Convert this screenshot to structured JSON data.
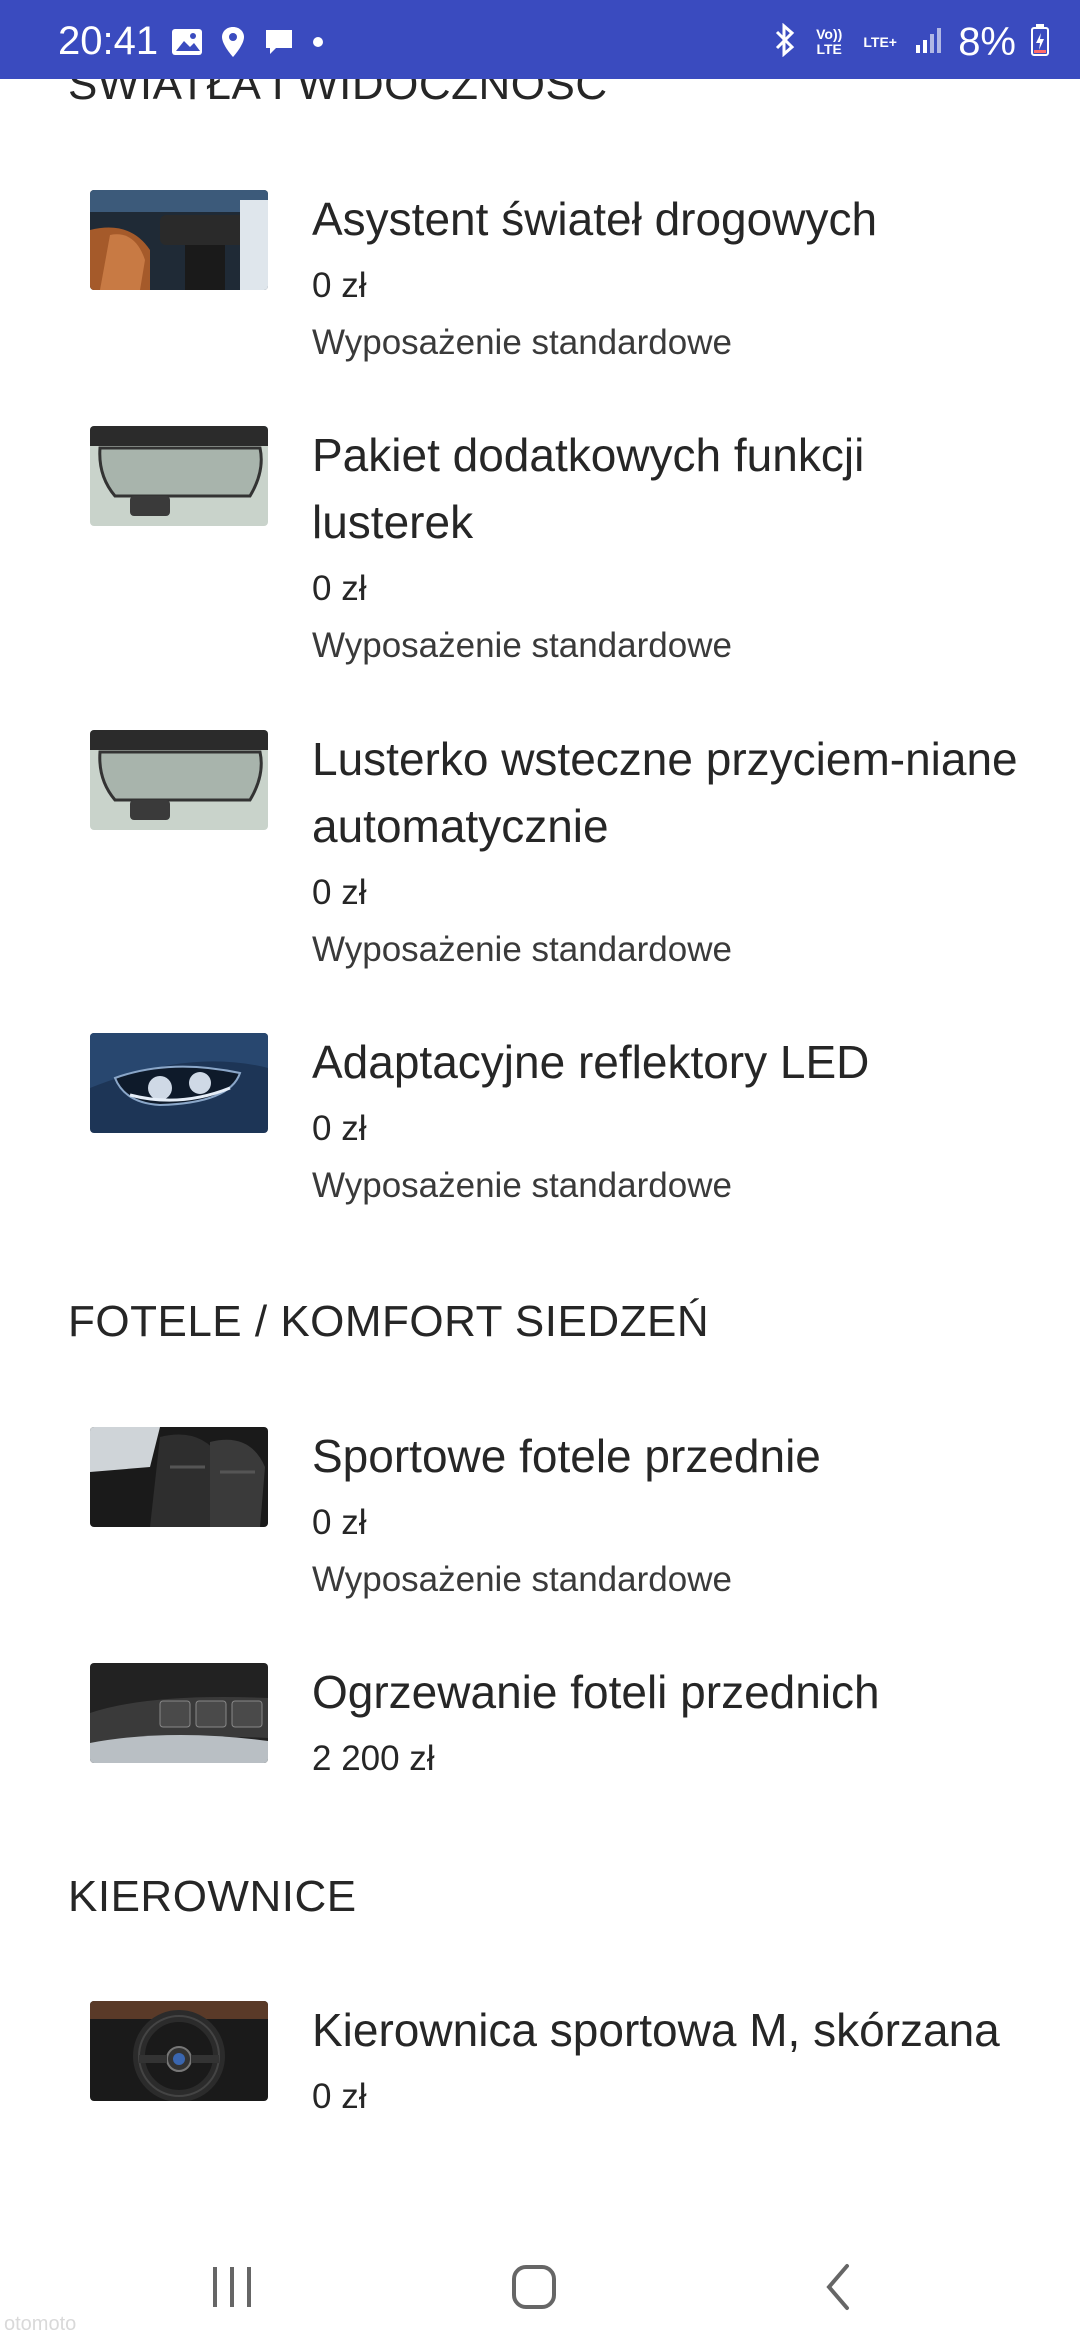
{
  "status_bar": {
    "time": "20:41",
    "left_icons": [
      "gallery-icon",
      "location-icon",
      "chat-icon",
      "dot-icon"
    ],
    "volte_label": "Vo)) LTE",
    "lte_label": "LTE+",
    "battery_percent": "8%",
    "right_icons": [
      "bluetooth-icon",
      "signal-icon",
      "battery-icon"
    ]
  },
  "sections": [
    {
      "title": "ŚWIATŁA I WIDOCZNOŚĆ",
      "items": [
        {
          "title": "Asystent świateł drogowych",
          "price": "0 zł",
          "note": "Wyposażenie standardowe"
        },
        {
          "title": "Pakiet dodatkowych funkcji lusterek",
          "price": "0 zł",
          "note": "Wyposażenie standardowe"
        },
        {
          "title": "Lusterko wsteczne przyciem-niane automatycznie",
          "price": "0 zł",
          "note": "Wyposażenie standardowe"
        },
        {
          "title": "Adaptacyjne reflektory LED",
          "price": "0 zł",
          "note": "Wyposażenie standardowe"
        }
      ]
    },
    {
      "title": "FOTELE / KOMFORT SIEDZEŃ",
      "items": [
        {
          "title": "Sportowe fotele przednie",
          "price": "0 zł",
          "note": "Wyposażenie standardowe"
        },
        {
          "title": "Ogrzewanie foteli przednich",
          "price": "2 200 zł"
        }
      ]
    },
    {
      "title": "KIEROWNICE",
      "items": [
        {
          "title": "Kierownica sportowa M, skórzana",
          "price": "0 zł"
        }
      ]
    }
  ],
  "nav_bar": {
    "buttons": [
      "recents-icon",
      "home-icon",
      "back-icon"
    ]
  },
  "watermark": "otomoto"
}
